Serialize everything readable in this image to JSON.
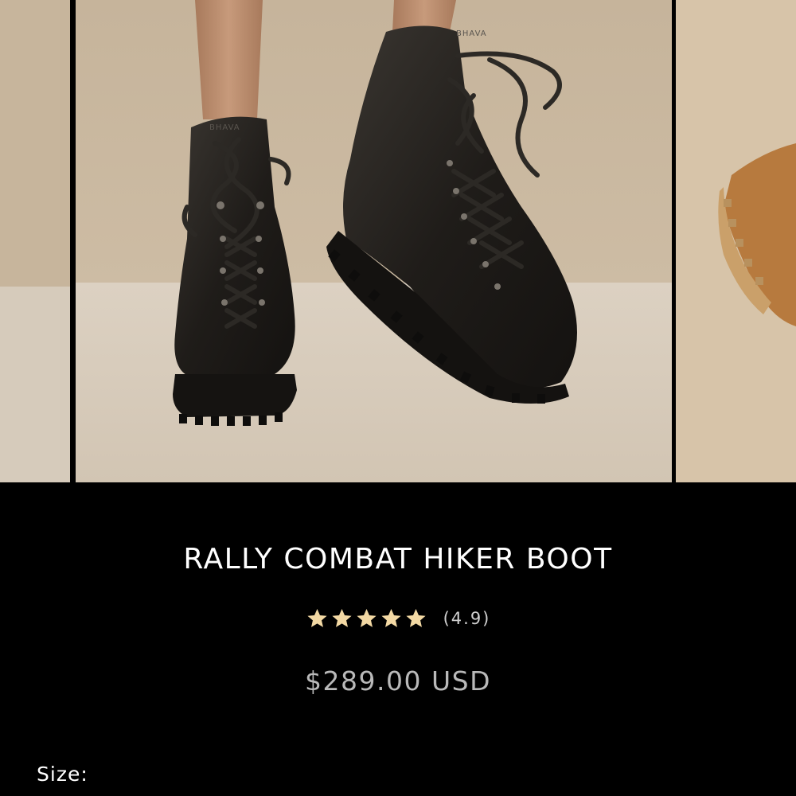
{
  "gallery": {
    "slides": [
      {
        "icon": "boot-photo-partial"
      },
      {
        "icon": "black-hiker-boots-photo",
        "brand_stamp": "BHAVA"
      },
      {
        "icon": "tan-boot-photo-partial"
      }
    ]
  },
  "product": {
    "title": "RALLY COMBAT HIKER BOOT",
    "rating": {
      "stars": 5,
      "value_text": "(4.9)",
      "star_color": "#f3d9a4"
    },
    "price": "$289.00 USD"
  },
  "options": {
    "size_label": "Size:"
  },
  "colors": {
    "background": "#000000",
    "title": "#ffffff",
    "price": "#b9b9b9",
    "star": "#f3d9a4"
  }
}
